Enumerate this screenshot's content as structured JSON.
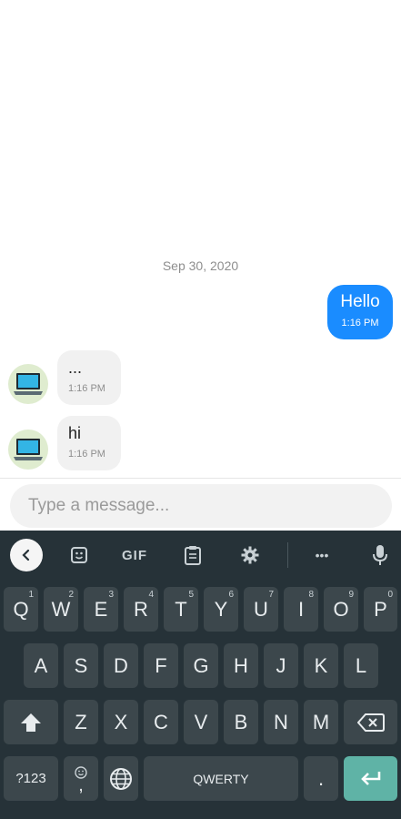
{
  "chat": {
    "date": "Sep 30, 2020",
    "messages": [
      {
        "direction": "out",
        "text": "Hello",
        "time": "1:16 PM"
      },
      {
        "direction": "in",
        "text": "...",
        "time": "1:16 PM",
        "avatar": "laptop-icon"
      },
      {
        "direction": "in",
        "text": "hi",
        "time": "1:16 PM",
        "avatar": "laptop-icon"
      }
    ]
  },
  "composer": {
    "placeholder": "Type a message...",
    "value": ""
  },
  "keyboard": {
    "toolbar": {
      "gif_label": "GIF",
      "more_label": "•••"
    },
    "row1": [
      {
        "key": "Q",
        "hint": "1"
      },
      {
        "key": "W",
        "hint": "2"
      },
      {
        "key": "E",
        "hint": "3"
      },
      {
        "key": "R",
        "hint": "4"
      },
      {
        "key": "T",
        "hint": "5"
      },
      {
        "key": "Y",
        "hint": "6"
      },
      {
        "key": "U",
        "hint": "7"
      },
      {
        "key": "I",
        "hint": "8"
      },
      {
        "key": "O",
        "hint": "9"
      },
      {
        "key": "P",
        "hint": "0"
      }
    ],
    "row2": [
      "A",
      "S",
      "D",
      "F",
      "G",
      "H",
      "J",
      "K",
      "L"
    ],
    "row3": [
      "Z",
      "X",
      "C",
      "V",
      "B",
      "N",
      "M"
    ],
    "symbols_label": "?123",
    "comma_label": ",",
    "space_label": "QWERTY",
    "period_label": "."
  },
  "colors": {
    "accent": "#1a8cff",
    "keyboard_bg": "#263238",
    "key_bg": "#3c474c",
    "enter_key": "#5fb3a6"
  }
}
